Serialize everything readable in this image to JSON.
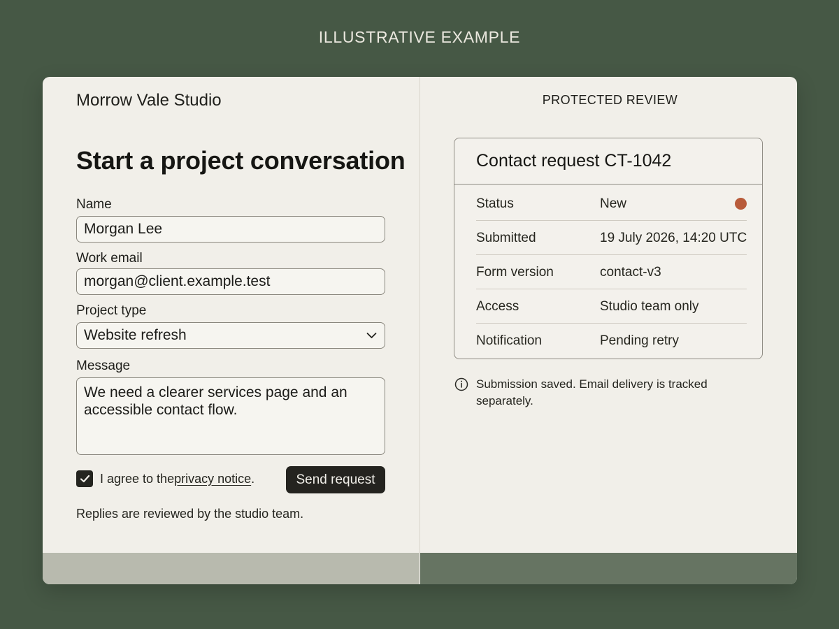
{
  "banner": {
    "label": "ILLUSTRATIVE EXAMPLE"
  },
  "left_panel": {
    "brand": "Morrow Vale Studio",
    "title": "Start a project conversation",
    "fields": {
      "name_label": "Name",
      "name_value": "Morgan Lee",
      "email_label": "Work email",
      "email_value": "morgan@client.example.test",
      "project_type_label": "Project type",
      "project_type_value": "Website refresh",
      "message_label": "Message",
      "message_value": "We need a clearer services page and an accessible contact flow."
    },
    "consent": {
      "checked": true,
      "prefix": "I agree to the ",
      "link": "privacy notice",
      "suffix": "."
    },
    "send_button": "Send request",
    "footnote": "Replies are reviewed by the studio team."
  },
  "right_panel": {
    "label": "PROTECTED REVIEW",
    "card_title": "Contact request CT-1042",
    "rows": [
      {
        "key": "Status",
        "value": "New"
      },
      {
        "key": "Submitted",
        "value": "19 July 2026, 14:20 UTC"
      },
      {
        "key": "Form version",
        "value": "contact-v3"
      },
      {
        "key": "Access",
        "value": "Studio team only"
      },
      {
        "key": "Notification",
        "value": "Pending retry"
      }
    ],
    "status_color": "#b85b3a",
    "info_note": "Submission saved. Email delivery is tracked separately."
  },
  "colors": {
    "background": "#465845",
    "card": "#f1efe9",
    "accent_dark": "#24231f",
    "footer_light": "#b8baae",
    "footer_dark": "#667462"
  },
  "icons": {
    "chevron": "chevron-down-icon",
    "check": "check-icon",
    "info": "info-icon",
    "status": "status-dot-icon"
  }
}
